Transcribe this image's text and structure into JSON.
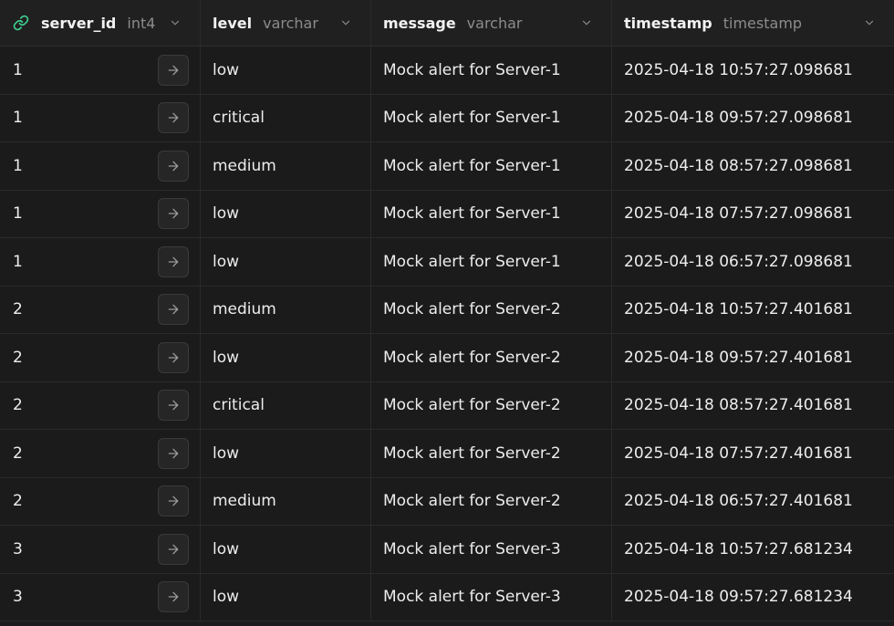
{
  "columns": [
    {
      "name": "server_id",
      "type": "int4",
      "icon": "link-icon"
    },
    {
      "name": "level",
      "type": "varchar"
    },
    {
      "name": "message",
      "type": "varchar"
    },
    {
      "name": "timestamp",
      "type": "timestamp"
    }
  ],
  "rows": [
    {
      "server_id": "1",
      "level": "low",
      "message": "Mock alert for Server-1",
      "timestamp": "2025-04-18 10:57:27.098681"
    },
    {
      "server_id": "1",
      "level": "critical",
      "message": "Mock alert for Server-1",
      "timestamp": "2025-04-18 09:57:27.098681"
    },
    {
      "server_id": "1",
      "level": "medium",
      "message": "Mock alert for Server-1",
      "timestamp": "2025-04-18 08:57:27.098681"
    },
    {
      "server_id": "1",
      "level": "low",
      "message": "Mock alert for Server-1",
      "timestamp": "2025-04-18 07:57:27.098681"
    },
    {
      "server_id": "1",
      "level": "low",
      "message": "Mock alert for Server-1",
      "timestamp": "2025-04-18 06:57:27.098681"
    },
    {
      "server_id": "2",
      "level": "medium",
      "message": "Mock alert for Server-2",
      "timestamp": "2025-04-18 10:57:27.401681"
    },
    {
      "server_id": "2",
      "level": "low",
      "message": "Mock alert for Server-2",
      "timestamp": "2025-04-18 09:57:27.401681"
    },
    {
      "server_id": "2",
      "level": "critical",
      "message": "Mock alert for Server-2",
      "timestamp": "2025-04-18 08:57:27.401681"
    },
    {
      "server_id": "2",
      "level": "low",
      "message": "Mock alert for Server-2",
      "timestamp": "2025-04-18 07:57:27.401681"
    },
    {
      "server_id": "2",
      "level": "medium",
      "message": "Mock alert for Server-2",
      "timestamp": "2025-04-18 06:57:27.401681"
    },
    {
      "server_id": "3",
      "level": "low",
      "message": "Mock alert for Server-3",
      "timestamp": "2025-04-18 10:57:27.681234"
    },
    {
      "server_id": "3",
      "level": "low",
      "message": "Mock alert for Server-3",
      "timestamp": "2025-04-18 09:57:27.681234"
    }
  ],
  "colors": {
    "background": "#1c1c1c",
    "header_bg": "#202020",
    "border": "#2a2a2a",
    "text": "#ededed",
    "type_text": "#8c8c8c",
    "link_icon": "#3ecf8e"
  }
}
